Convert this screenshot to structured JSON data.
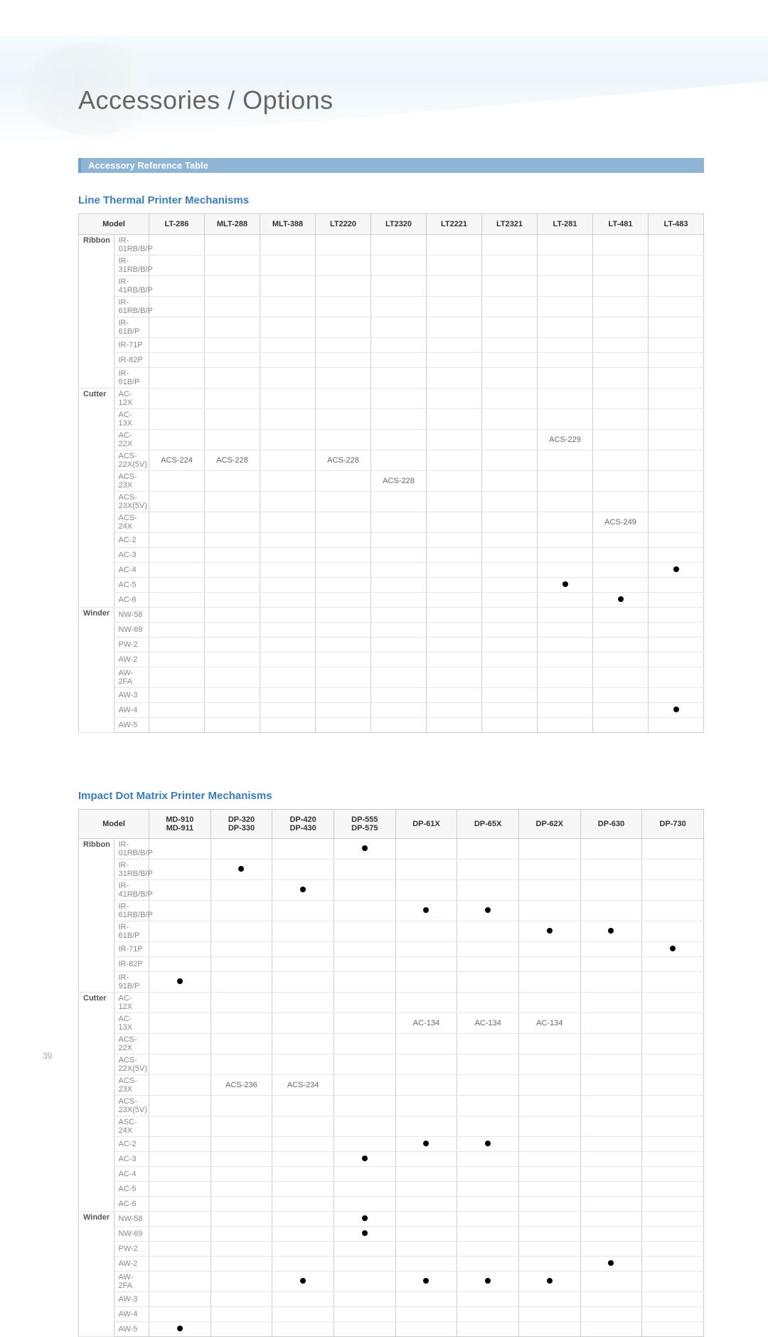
{
  "page_number": "39",
  "title": "Accessories / Options",
  "section_bar": "Accessory Reference Table",
  "table1": {
    "heading": "Line Thermal Printer Mechanisms",
    "model_header": "Model",
    "columns": [
      "LT-286",
      "MLT-288",
      "MLT-388",
      "LT2220",
      "LT2320",
      "LT2221",
      "LT2321",
      "LT-281",
      "LT-481",
      "LT-483"
    ],
    "groups": [
      {
        "name": "Ribbon",
        "rows": [
          {
            "item": "IR-01RB/B/P",
            "cells": [
              "",
              "",
              "",
              "",
              "",
              "",
              "",
              "",
              "",
              ""
            ]
          },
          {
            "item": "IR-31RB/B/P",
            "cells": [
              "",
              "",
              "",
              "",
              "",
              "",
              "",
              "",
              "",
              ""
            ]
          },
          {
            "item": "IR-41RB/B/P",
            "cells": [
              "",
              "",
              "",
              "",
              "",
              "",
              "",
              "",
              "",
              ""
            ]
          },
          {
            "item": "IR-61RB/B/P",
            "cells": [
              "",
              "",
              "",
              "",
              "",
              "",
              "",
              "",
              "",
              ""
            ]
          },
          {
            "item": "IR-61B/P",
            "cells": [
              "",
              "",
              "",
              "",
              "",
              "",
              "",
              "",
              "",
              ""
            ]
          },
          {
            "item": "IR-71P",
            "cells": [
              "",
              "",
              "",
              "",
              "",
              "",
              "",
              "",
              "",
              ""
            ]
          },
          {
            "item": "IR-82P",
            "cells": [
              "",
              "",
              "",
              "",
              "",
              "",
              "",
              "",
              "",
              ""
            ]
          },
          {
            "item": "IR-91B/P",
            "cells": [
              "",
              "",
              "",
              "",
              "",
              "",
              "",
              "",
              "",
              ""
            ]
          }
        ]
      },
      {
        "name": "Cutter",
        "rows": [
          {
            "item": "AC-12X",
            "cells": [
              "",
              "",
              "",
              "",
              "",
              "",
              "",
              "",
              "",
              ""
            ]
          },
          {
            "item": "AC-13X",
            "cells": [
              "",
              "",
              "",
              "",
              "",
              "",
              "",
              "",
              "",
              ""
            ]
          },
          {
            "item": "AC-22X",
            "cells": [
              "",
              "",
              "",
              "",
              "",
              "",
              "",
              "ACS-229",
              "",
              ""
            ]
          },
          {
            "item": "ACS-22X(5V)",
            "cells": [
              "ACS-224",
              "ACS-228",
              "",
              "ACS-228",
              "",
              "",
              "",
              "",
              "",
              ""
            ]
          },
          {
            "item": "ACS-23X",
            "cells": [
              "",
              "",
              "",
              "",
              "ACS-228",
              "",
              "",
              "",
              "",
              ""
            ]
          },
          {
            "item": "ACS-23X(5V)",
            "cells": [
              "",
              "",
              "",
              "",
              "",
              "",
              "",
              "",
              "",
              ""
            ]
          },
          {
            "item": "ACS-24X",
            "cells": [
              "",
              "",
              "",
              "",
              "",
              "",
              "",
              "",
              "ACS-249",
              ""
            ]
          },
          {
            "item": "AC-2",
            "cells": [
              "",
              "",
              "",
              "",
              "",
              "",
              "",
              "",
              "",
              ""
            ]
          },
          {
            "item": "AC-3",
            "cells": [
              "",
              "",
              "",
              "",
              "",
              "",
              "",
              "",
              "",
              ""
            ]
          },
          {
            "item": "AC-4",
            "cells": [
              "",
              "",
              "",
              "",
              "",
              "",
              "",
              "",
              "",
              "●"
            ]
          },
          {
            "item": "AC-5",
            "cells": [
              "",
              "",
              "",
              "",
              "",
              "",
              "",
              "●",
              "",
              ""
            ]
          },
          {
            "item": "AC-6",
            "cells": [
              "",
              "",
              "",
              "",
              "",
              "",
              "",
              "",
              "●",
              ""
            ]
          }
        ]
      },
      {
        "name": "Winder",
        "rows": [
          {
            "item": "NW-58",
            "cells": [
              "",
              "",
              "",
              "",
              "",
              "",
              "",
              "",
              "",
              ""
            ]
          },
          {
            "item": "NW-69",
            "cells": [
              "",
              "",
              "",
              "",
              "",
              "",
              "",
              "",
              "",
              ""
            ]
          },
          {
            "item": "PW-2",
            "cells": [
              "",
              "",
              "",
              "",
              "",
              "",
              "",
              "",
              "",
              ""
            ]
          },
          {
            "item": "AW-2",
            "cells": [
              "",
              "",
              "",
              "",
              "",
              "",
              "",
              "",
              "",
              ""
            ]
          },
          {
            "item": "AW-2FA",
            "cells": [
              "",
              "",
              "",
              "",
              "",
              "",
              "",
              "",
              "",
              ""
            ]
          },
          {
            "item": "AW-3",
            "cells": [
              "",
              "",
              "",
              "",
              "",
              "",
              "",
              "",
              "",
              ""
            ]
          },
          {
            "item": "AW-4",
            "cells": [
              "",
              "",
              "",
              "",
              "",
              "",
              "",
              "",
              "",
              "●"
            ]
          },
          {
            "item": "AW-5",
            "cells": [
              "",
              "",
              "",
              "",
              "",
              "",
              "",
              "",
              "",
              ""
            ]
          }
        ]
      }
    ]
  },
  "table2": {
    "heading": "Impact Dot Matrix Printer Mechanisms",
    "model_header": "Model",
    "columns": [
      "MD-910\nMD-911",
      "DP-320\nDP-330",
      "DP-420\nDP-430",
      "DP-555\nDP-575",
      "DP-61X",
      "DP-65X",
      "DP-62X",
      "DP-630",
      "DP-730"
    ],
    "groups": [
      {
        "name": "Ribbon",
        "rows": [
          {
            "item": "IR-01RB/B/P",
            "cells": [
              "",
              "",
              "",
              "●",
              "",
              "",
              "",
              "",
              ""
            ]
          },
          {
            "item": "IR-31RB/B/P",
            "cells": [
              "",
              "●",
              "",
              "",
              "",
              "",
              "",
              "",
              ""
            ]
          },
          {
            "item": "IR-41RB/B/P",
            "cells": [
              "",
              "",
              "●",
              "",
              "",
              "",
              "",
              "",
              ""
            ]
          },
          {
            "item": "IR-61RB/B/P",
            "cells": [
              "",
              "",
              "",
              "",
              "●",
              "●",
              "",
              "",
              ""
            ]
          },
          {
            "item": "IR-61B/P",
            "cells": [
              "",
              "",
              "",
              "",
              "",
              "",
              "●",
              "●",
              ""
            ]
          },
          {
            "item": "IR-71P",
            "cells": [
              "",
              "",
              "",
              "",
              "",
              "",
              "",
              "",
              "●"
            ]
          },
          {
            "item": "IR-82P",
            "cells": [
              "",
              "",
              "",
              "",
              "",
              "",
              "",
              "",
              ""
            ]
          },
          {
            "item": "IR-91B/P",
            "cells": [
              "●",
              "",
              "",
              "",
              "",
              "",
              "",
              "",
              ""
            ]
          }
        ]
      },
      {
        "name": "Cutter",
        "rows": [
          {
            "item": "AC-12X",
            "cells": [
              "",
              "",
              "",
              "",
              "",
              "",
              "",
              "",
              ""
            ]
          },
          {
            "item": "AC-13X",
            "cells": [
              "",
              "",
              "",
              "",
              "AC-134",
              "AC-134",
              "AC-134",
              "",
              ""
            ]
          },
          {
            "item": "ACS-22X",
            "cells": [
              "",
              "",
              "",
              "",
              "",
              "",
              "",
              "",
              ""
            ]
          },
          {
            "item": "ACS-22X(5V)",
            "cells": [
              "",
              "",
              "",
              "",
              "",
              "",
              "",
              "",
              ""
            ]
          },
          {
            "item": "ACS-23X",
            "cells": [
              "",
              "ACS-236",
              "ACS-234",
              "",
              "",
              "",
              "",
              "",
              ""
            ]
          },
          {
            "item": "ACS-23X(5V)",
            "cells": [
              "",
              "",
              "",
              "",
              "",
              "",
              "",
              "",
              ""
            ]
          },
          {
            "item": "ASC-24X",
            "cells": [
              "",
              "",
              "",
              "",
              "",
              "",
              "",
              "",
              ""
            ]
          },
          {
            "item": "AC-2",
            "cells": [
              "",
              "",
              "",
              "",
              "●",
              "●",
              "",
              "",
              ""
            ]
          },
          {
            "item": "AC-3",
            "cells": [
              "",
              "",
              "",
              "●",
              "",
              "",
              "",
              "",
              ""
            ]
          },
          {
            "item": "AC-4",
            "cells": [
              "",
              "",
              "",
              "",
              "",
              "",
              "",
              "",
              ""
            ]
          },
          {
            "item": "AC-5",
            "cells": [
              "",
              "",
              "",
              "",
              "",
              "",
              "",
              "",
              ""
            ]
          },
          {
            "item": "AC-6",
            "cells": [
              "",
              "",
              "",
              "",
              "",
              "",
              "",
              "",
              ""
            ]
          }
        ]
      },
      {
        "name": "Winder",
        "rows": [
          {
            "item": "NW-58",
            "cells": [
              "",
              "",
              "",
              "●",
              "",
              "",
              "",
              "",
              ""
            ]
          },
          {
            "item": "NW-69",
            "cells": [
              "",
              "",
              "",
              "●",
              "",
              "",
              "",
              "",
              ""
            ]
          },
          {
            "item": "PW-2",
            "cells": [
              "",
              "",
              "",
              "",
              "",
              "",
              "",
              "",
              ""
            ]
          },
          {
            "item": "AW-2",
            "cells": [
              "",
              "",
              "",
              "",
              "",
              "",
              "",
              "●",
              ""
            ]
          },
          {
            "item": "AW-2FA",
            "cells": [
              "",
              "",
              "●",
              "",
              "●",
              "●",
              "●",
              "",
              ""
            ]
          },
          {
            "item": "AW-3",
            "cells": [
              "",
              "",
              "",
              "",
              "",
              "",
              "",
              "",
              ""
            ]
          },
          {
            "item": "AW-4",
            "cells": [
              "",
              "",
              "",
              "",
              "",
              "",
              "",
              "",
              ""
            ]
          },
          {
            "item": "AW-5",
            "cells": [
              "●",
              "",
              "",
              "",
              "",
              "",
              "",
              "",
              ""
            ]
          }
        ]
      }
    ]
  }
}
